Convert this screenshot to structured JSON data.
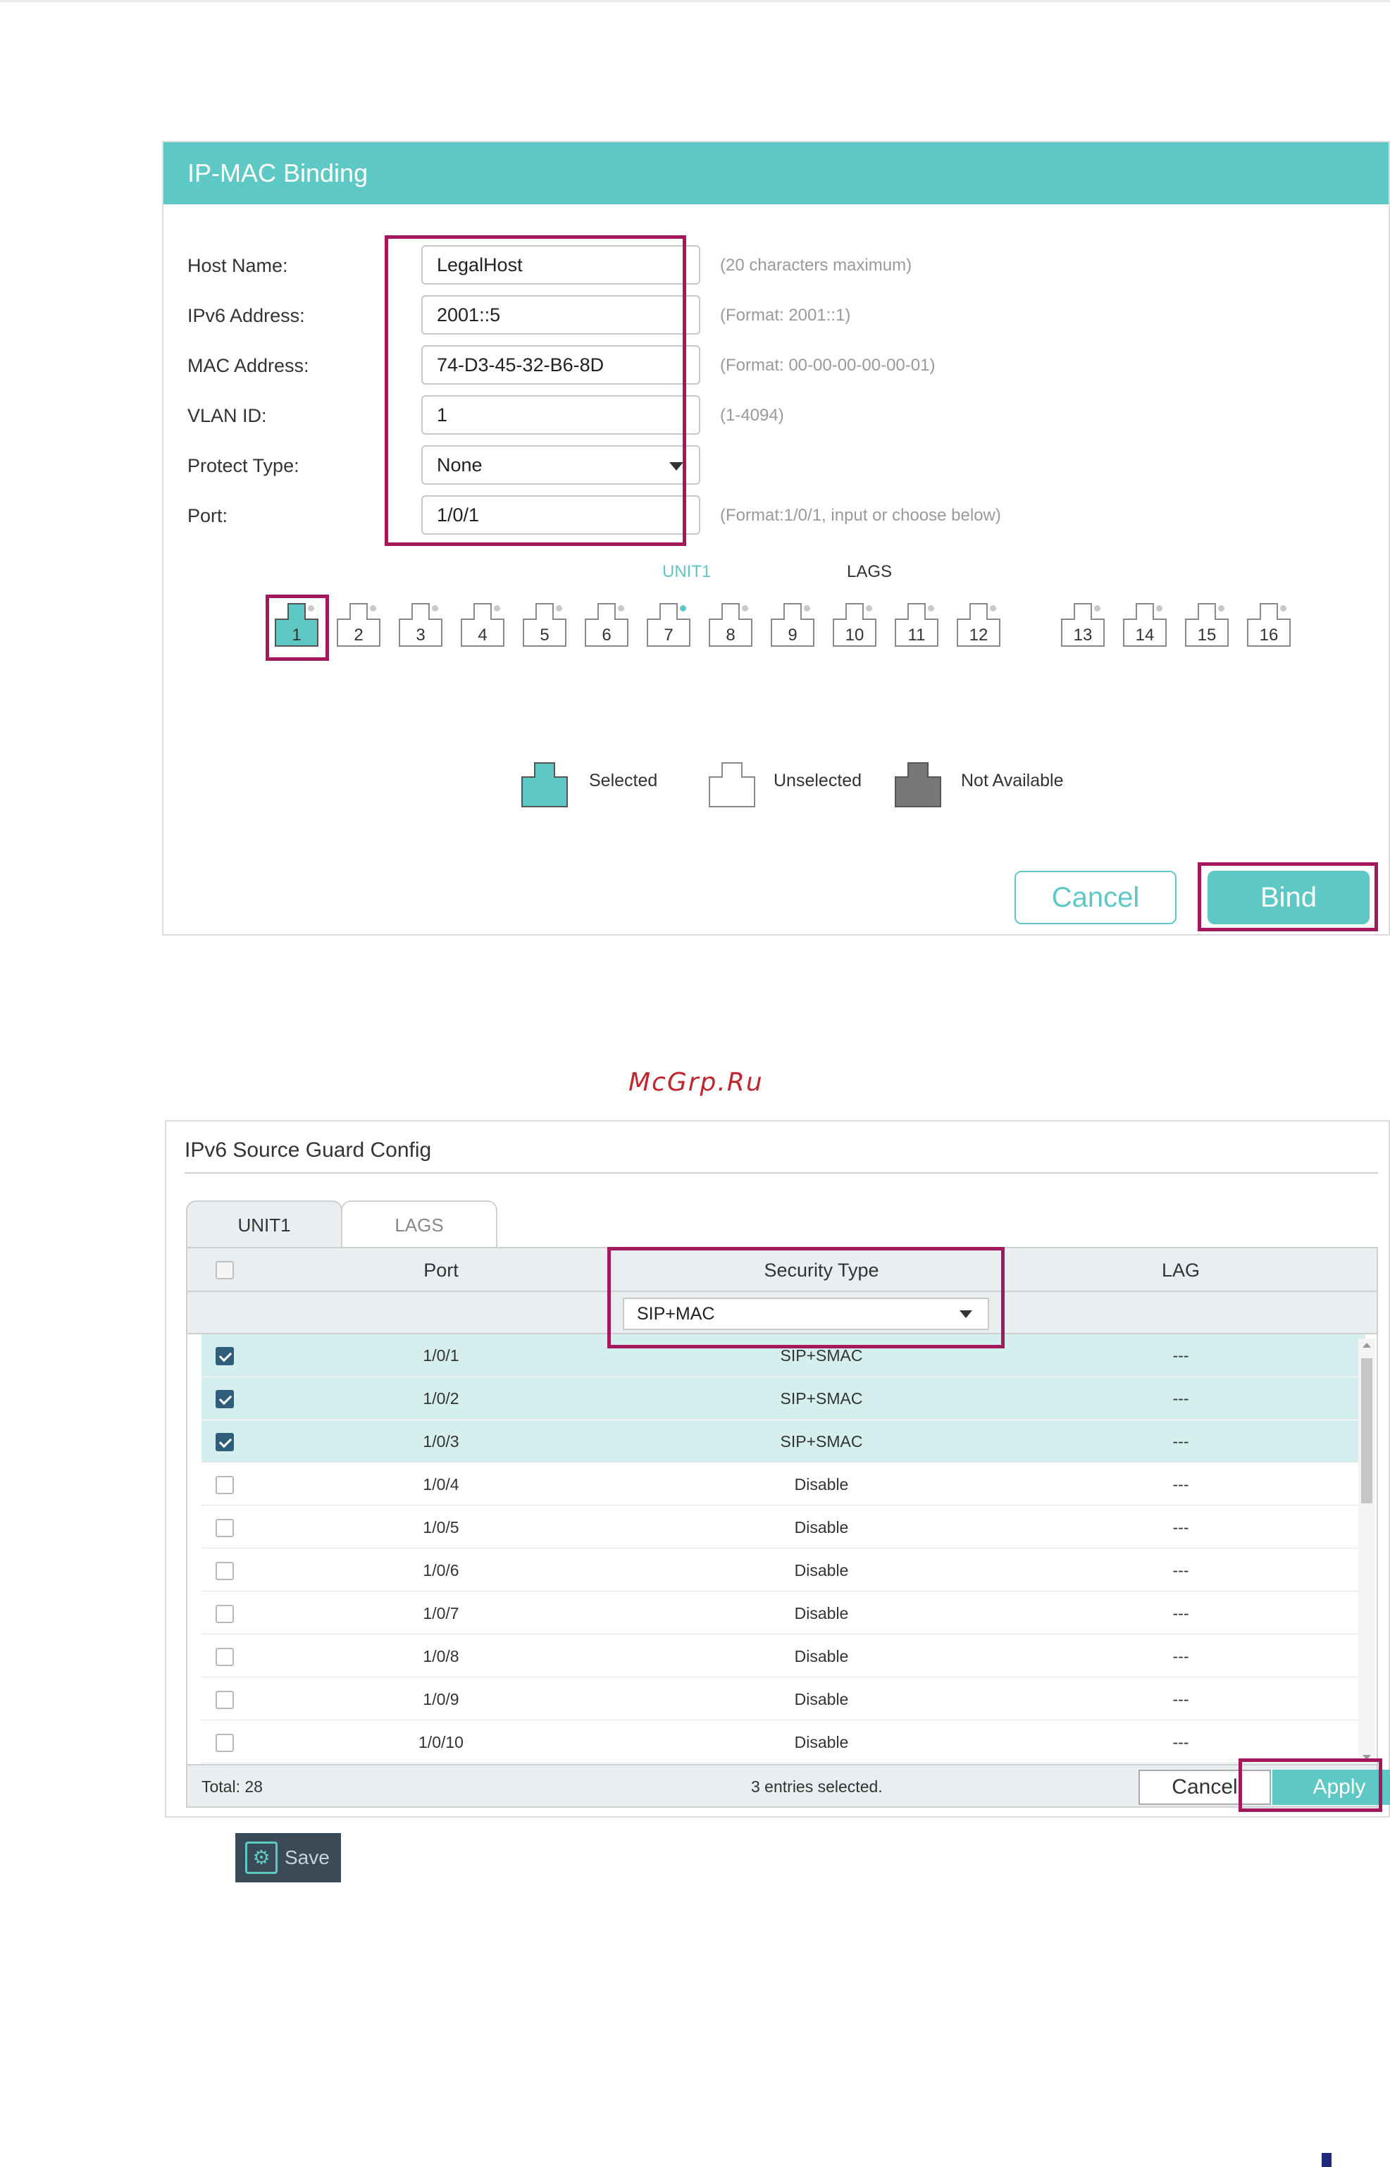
{
  "ipmac": {
    "title": "IP-MAC Binding",
    "fields": [
      {
        "label": "Host Name:",
        "value": "LegalHost",
        "hint": "(20 characters maximum)"
      },
      {
        "label": "IPv6 Address:",
        "value": "2001::5",
        "hint": "(Format: 2001::1)"
      },
      {
        "label": "MAC Address:",
        "value": "74-D3-45-32-B6-8D",
        "hint": "(Format: 00-00-00-00-00-01)"
      },
      {
        "label": "VLAN ID:",
        "value": "1",
        "hint": "(1-4094)"
      },
      {
        "label": "Protect Type:",
        "value": "None",
        "hint": ""
      },
      {
        "label": "Port:",
        "value": "1/0/1",
        "hint": "(Format:1/0/1, input or choose below)"
      }
    ],
    "unit_label": "UNIT1",
    "lags_label": "LAGS",
    "ports": [
      "1",
      "2",
      "3",
      "4",
      "5",
      "6",
      "7",
      "8",
      "9",
      "10",
      "11",
      "12",
      "13",
      "14",
      "15",
      "16"
    ],
    "selected_port": "1",
    "active_led_port": "7",
    "legend": {
      "selected": "Selected",
      "unselected": "Unselected",
      "not_available": "Not Available"
    },
    "cancel_label": "Cancel",
    "bind_label": "Bind",
    "colors": {
      "accent": "#5ec8c4",
      "highlight": "#a3195b"
    }
  },
  "watermark": "McGrp.Ru",
  "guard": {
    "title": "IPv6 Source Guard Config",
    "tabs": [
      "UNIT1",
      "LAGS"
    ],
    "columns": {
      "port": "Port",
      "security": "Security Type",
      "lag": "LAG"
    },
    "filter_value": "SIP+MAC",
    "rows": [
      {
        "port": "1/0/1",
        "security": "SIP+SMAC",
        "lag": "---",
        "checked": true
      },
      {
        "port": "1/0/2",
        "security": "SIP+SMAC",
        "lag": "---",
        "checked": true
      },
      {
        "port": "1/0/3",
        "security": "SIP+SMAC",
        "lag": "---",
        "checked": true
      },
      {
        "port": "1/0/4",
        "security": "Disable",
        "lag": "---",
        "checked": false
      },
      {
        "port": "1/0/5",
        "security": "Disable",
        "lag": "---",
        "checked": false
      },
      {
        "port": "1/0/6",
        "security": "Disable",
        "lag": "---",
        "checked": false
      },
      {
        "port": "1/0/7",
        "security": "Disable",
        "lag": "---",
        "checked": false
      },
      {
        "port": "1/0/8",
        "security": "Disable",
        "lag": "---",
        "checked": false
      },
      {
        "port": "1/0/9",
        "security": "Disable",
        "lag": "---",
        "checked": false
      },
      {
        "port": "1/0/10",
        "security": "Disable",
        "lag": "---",
        "checked": false
      }
    ],
    "total": "Total: 28",
    "selected_text": "3 entries selected.",
    "cancel_label": "Cancel",
    "apply_label": "Apply"
  },
  "save_label": "Save"
}
